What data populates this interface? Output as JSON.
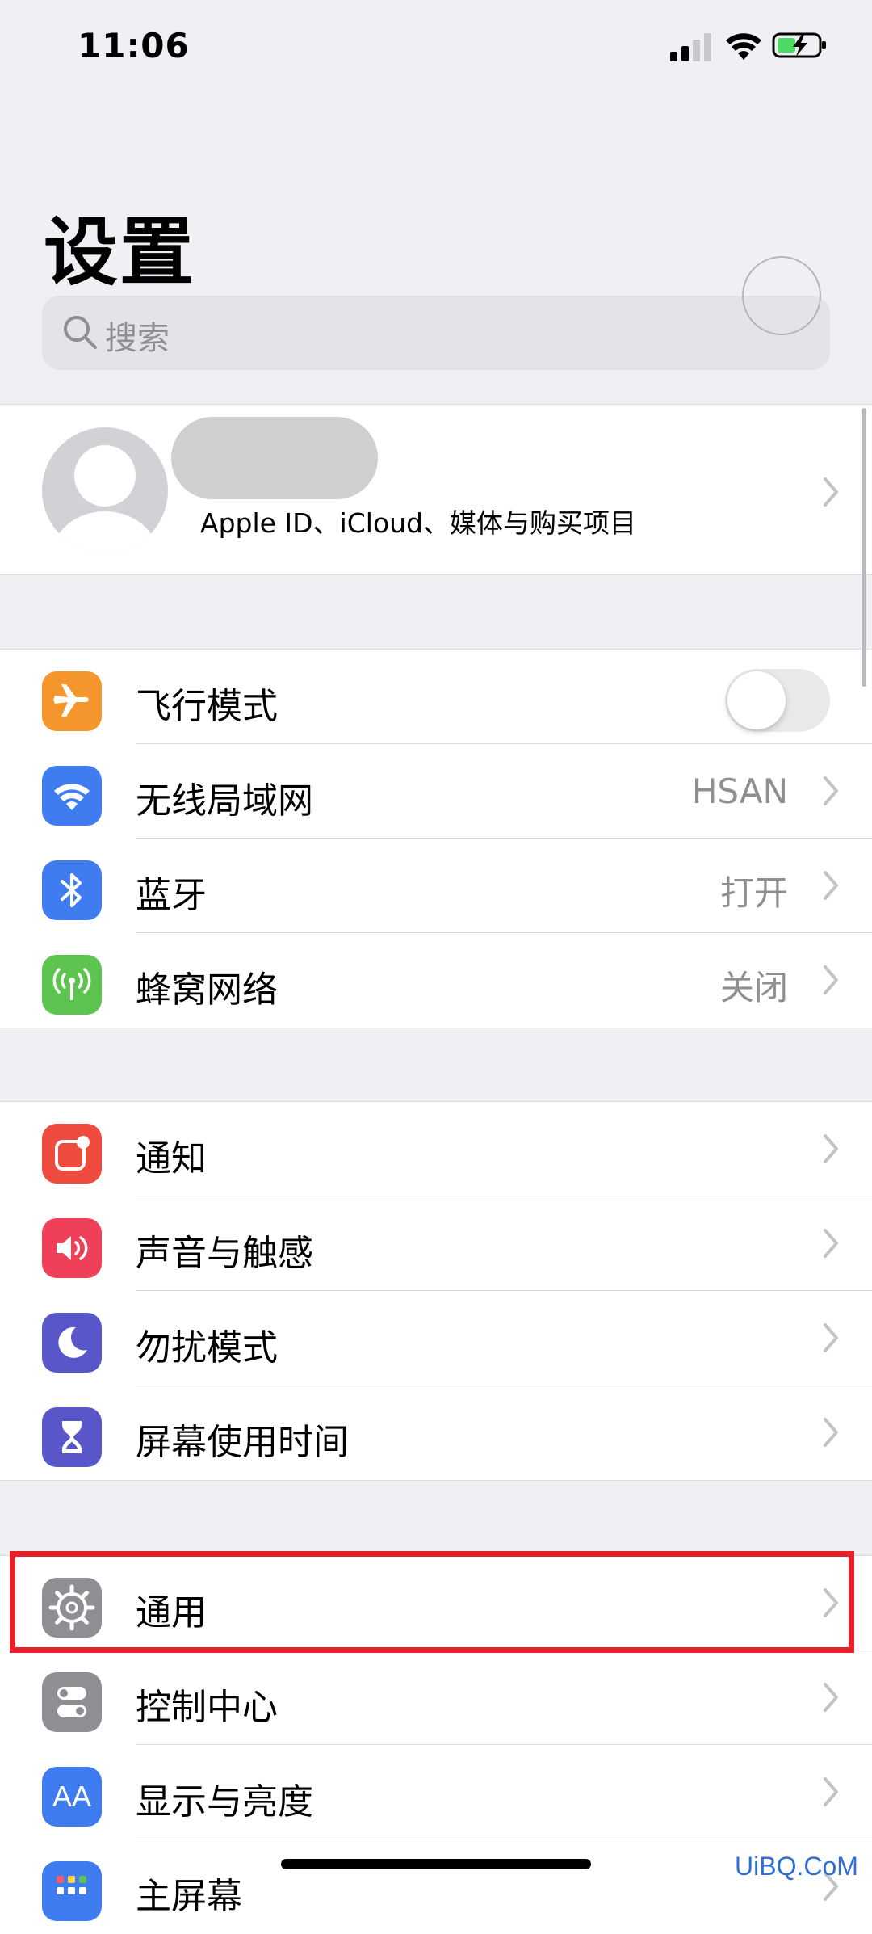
{
  "status": {
    "time": "11:06"
  },
  "header": {
    "title": "设置",
    "search_placeholder": "搜索"
  },
  "profile": {
    "subtitle": "Apple ID、iCloud、媒体与购买项目"
  },
  "group1": [
    {
      "label": "飞行模式",
      "icon": "airplane-icon",
      "color": "#f4962c",
      "toggle": false
    },
    {
      "label": "无线局域网",
      "icon": "wifi-icon",
      "color": "#3e7cf0",
      "value": "HSAN"
    },
    {
      "label": "蓝牙",
      "icon": "bluetooth-icon",
      "color": "#3e7cf0",
      "value": "打开"
    },
    {
      "label": "蜂窝网络",
      "icon": "cellular-icon",
      "color": "#5dc44f",
      "value": "关闭"
    }
  ],
  "group2": [
    {
      "label": "通知",
      "icon": "notifications-icon",
      "color": "#ee4b3e"
    },
    {
      "label": "声音与触感",
      "icon": "sound-icon",
      "color": "#ef3f59"
    },
    {
      "label": "勿扰模式",
      "icon": "moon-icon",
      "color": "#5856c9"
    },
    {
      "label": "屏幕使用时间",
      "icon": "hourglass-icon",
      "color": "#5856c9"
    }
  ],
  "group3": [
    {
      "label": "通用",
      "icon": "gear-icon",
      "color": "#8e8e93"
    },
    {
      "label": "控制中心",
      "icon": "control-center-icon",
      "color": "#8e8e93"
    },
    {
      "label": "显示与亮度",
      "icon": "display-icon",
      "color": "#3e7cf0",
      "icon_text": "AA"
    },
    {
      "label": "主屏幕",
      "icon": "home-screen-icon",
      "color": "#3e7cf0"
    }
  ],
  "watermark": "UiBQ.CoM"
}
